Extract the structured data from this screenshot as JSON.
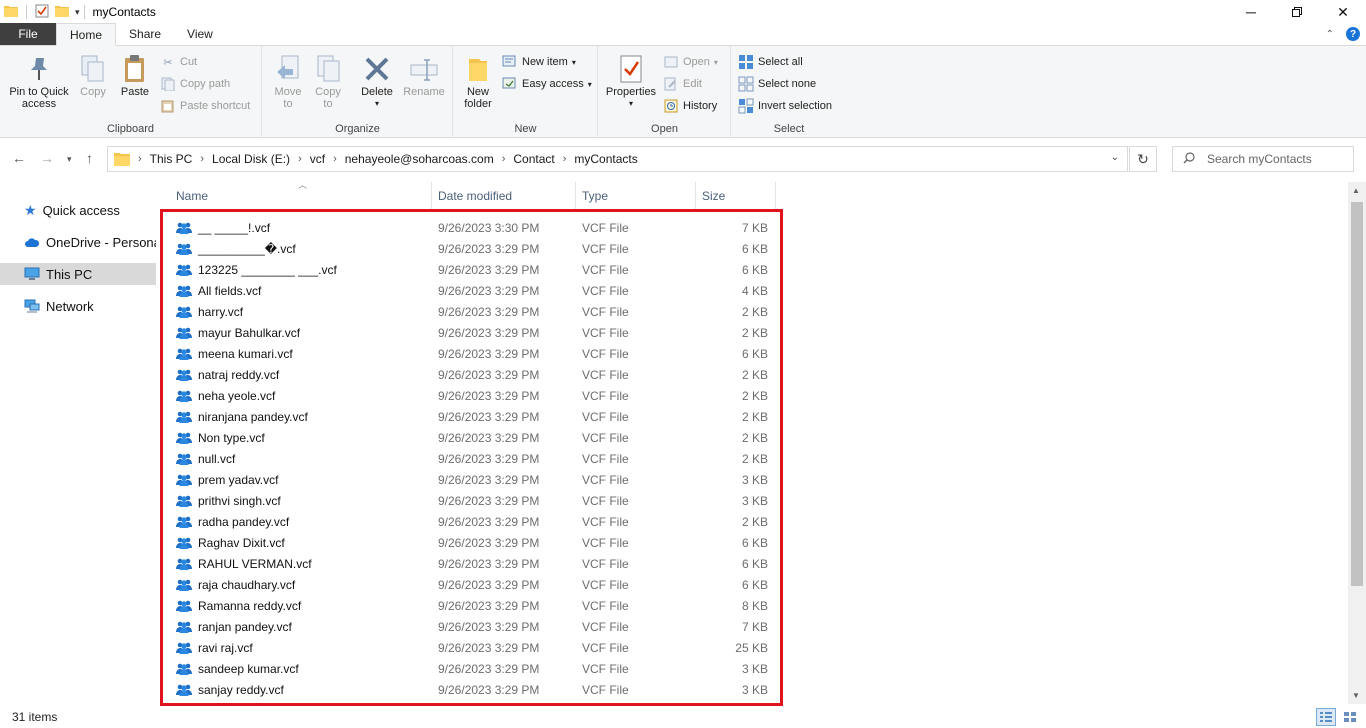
{
  "window": {
    "title": "myContacts"
  },
  "tabs": [
    {
      "label": "File"
    },
    {
      "label": "Home"
    },
    {
      "label": "Share"
    },
    {
      "label": "View"
    }
  ],
  "ribbon": {
    "clipboard": {
      "label": "Clipboard",
      "pin": "Pin to Quick",
      "pin2": "access",
      "copy": "Copy",
      "paste": "Paste",
      "cut": "Cut",
      "copy_path": "Copy path",
      "paste_shortcut": "Paste shortcut"
    },
    "organize": {
      "label": "Organize",
      "move": "Move",
      "move2": "to",
      "copy": "Copy",
      "copy2": "to",
      "delete": "Delete",
      "rename": "Rename"
    },
    "new": {
      "label": "New",
      "new_folder": "New",
      "new_folder2": "folder",
      "new_item": "New item",
      "easy_access": "Easy access"
    },
    "open": {
      "label": "Open",
      "properties": "Properties",
      "open": "Open",
      "edit": "Edit",
      "history": "History"
    },
    "select": {
      "label": "Select",
      "select_all": "Select all",
      "select_none": "Select none",
      "invert": "Invert selection"
    }
  },
  "address": {
    "crumbs": [
      "This PC",
      "Local Disk (E:)",
      "vcf",
      "nehayeole@soharcoas.com",
      "Contact",
      "myContacts"
    ],
    "search_placeholder": "Search myContacts"
  },
  "navpane": [
    {
      "label": "Quick access",
      "icon": "star-icon"
    },
    {
      "label": "OneDrive - Personal",
      "icon": "cloud-icon"
    },
    {
      "label": "This PC",
      "icon": "computer-icon"
    },
    {
      "label": "Network",
      "icon": "network-icon"
    }
  ],
  "columns": {
    "name": "Name",
    "date": "Date modified",
    "type": "Type",
    "size": "Size"
  },
  "files": [
    {
      "name": "__ _____!.vcf",
      "date": "9/26/2023 3:30 PM",
      "type": "VCF File",
      "size": "7 KB"
    },
    {
      "name": "__________�.vcf",
      "date": "9/26/2023 3:29 PM",
      "type": "VCF File",
      "size": "6 KB"
    },
    {
      "name": "123225 ________ ___.vcf",
      "date": "9/26/2023 3:29 PM",
      "type": "VCF File",
      "size": "6 KB"
    },
    {
      "name": "All fields.vcf",
      "date": "9/26/2023 3:29 PM",
      "type": "VCF File",
      "size": "4 KB"
    },
    {
      "name": "harry.vcf",
      "date": "9/26/2023 3:29 PM",
      "type": "VCF File",
      "size": "2 KB"
    },
    {
      "name": "mayur Bahulkar.vcf",
      "date": "9/26/2023 3:29 PM",
      "type": "VCF File",
      "size": "2 KB"
    },
    {
      "name": "meena kumari.vcf",
      "date": "9/26/2023 3:29 PM",
      "type": "VCF File",
      "size": "6 KB"
    },
    {
      "name": "natraj reddy.vcf",
      "date": "9/26/2023 3:29 PM",
      "type": "VCF File",
      "size": "2 KB"
    },
    {
      "name": "neha yeole.vcf",
      "date": "9/26/2023 3:29 PM",
      "type": "VCF File",
      "size": "2 KB"
    },
    {
      "name": "niranjana pandey.vcf",
      "date": "9/26/2023 3:29 PM",
      "type": "VCF File",
      "size": "2 KB"
    },
    {
      "name": "Non type.vcf",
      "date": "9/26/2023 3:29 PM",
      "type": "VCF File",
      "size": "2 KB"
    },
    {
      "name": "null.vcf",
      "date": "9/26/2023 3:29 PM",
      "type": "VCF File",
      "size": "2 KB"
    },
    {
      "name": "prem yadav.vcf",
      "date": "9/26/2023 3:29 PM",
      "type": "VCF File",
      "size": "3 KB"
    },
    {
      "name": "prithvi singh.vcf",
      "date": "9/26/2023 3:29 PM",
      "type": "VCF File",
      "size": "3 KB"
    },
    {
      "name": "radha pandey.vcf",
      "date": "9/26/2023 3:29 PM",
      "type": "VCF File",
      "size": "2 KB"
    },
    {
      "name": "Raghav Dixit.vcf",
      "date": "9/26/2023 3:29 PM",
      "type": "VCF File",
      "size": "6 KB"
    },
    {
      "name": "RAHUL VERMAN.vcf",
      "date": "9/26/2023 3:29 PM",
      "type": "VCF File",
      "size": "6 KB"
    },
    {
      "name": "raja chaudhary.vcf",
      "date": "9/26/2023 3:29 PM",
      "type": "VCF File",
      "size": "6 KB"
    },
    {
      "name": "Ramanna reddy.vcf",
      "date": "9/26/2023 3:29 PM",
      "type": "VCF File",
      "size": "8 KB"
    },
    {
      "name": "ranjan pandey.vcf",
      "date": "9/26/2023 3:29 PM",
      "type": "VCF File",
      "size": "7 KB"
    },
    {
      "name": "ravi raj.vcf",
      "date": "9/26/2023 3:29 PM",
      "type": "VCF File",
      "size": "25 KB"
    },
    {
      "name": "sandeep kumar.vcf",
      "date": "9/26/2023 3:29 PM",
      "type": "VCF File",
      "size": "3 KB"
    },
    {
      "name": "sanjay reddy.vcf",
      "date": "9/26/2023 3:29 PM",
      "type": "VCF File",
      "size": "3 KB"
    }
  ],
  "status": {
    "items": "31 items"
  },
  "colors": {
    "highlight": "#e0141e",
    "accent": "#1a73d9",
    "file_tab": "#3f3f3f"
  }
}
